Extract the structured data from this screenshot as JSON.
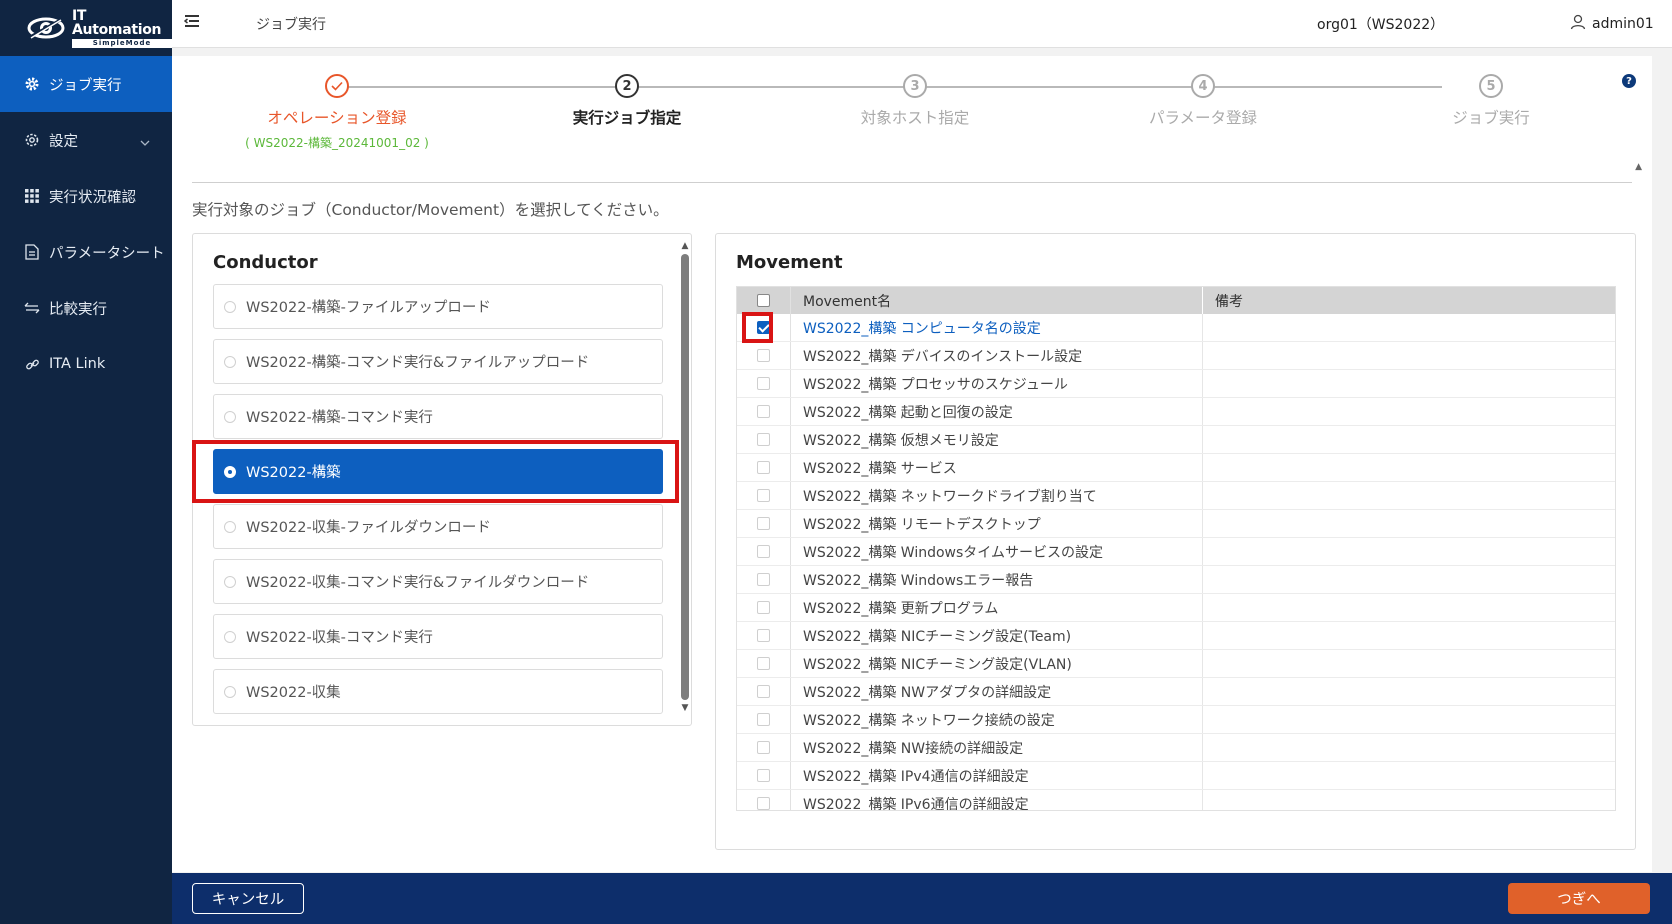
{
  "app": {
    "logo_title": "IT Automation",
    "logo_subtitle": "SimpleMode"
  },
  "sidebar": {
    "items": [
      {
        "label": "ジョブ実行",
        "icon": "gear-icon",
        "active": true
      },
      {
        "label": "設定",
        "icon": "gear-outline-icon",
        "has_chevron": true
      },
      {
        "label": "実行状況確認",
        "icon": "grid-icon"
      },
      {
        "label": "パラメータシート",
        "icon": "document-icon"
      },
      {
        "label": "比較実行",
        "icon": "compare-arrows-icon"
      },
      {
        "label": "ITA Link",
        "icon": "link-icon"
      }
    ]
  },
  "header": {
    "title": "ジョブ実行",
    "org": "org01（WS2022）",
    "user": "admin01"
  },
  "stepper": {
    "steps": [
      {
        "num": "✓",
        "label": "オペレーション登録",
        "sub": "( WS2022-構築_20241001_02 )",
        "state": "done"
      },
      {
        "num": "2",
        "label": "実行ジョブ指定",
        "state": "active"
      },
      {
        "num": "3",
        "label": "対象ホスト指定",
        "state": "pending"
      },
      {
        "num": "4",
        "label": "パラメータ登録",
        "state": "pending"
      },
      {
        "num": "5",
        "label": "ジョブ実行",
        "state": "pending"
      }
    ]
  },
  "instruction": "実行対象のジョブ（Conductor/Movement）を選択してください。",
  "conductor": {
    "title": "Conductor",
    "items": [
      {
        "label": "WS2022-構築-ファイルアップロード",
        "selected": false
      },
      {
        "label": "WS2022-構築-コマンド実行&ファイルアップロード",
        "selected": false
      },
      {
        "label": "WS2022-構築-コマンド実行",
        "selected": false
      },
      {
        "label": "WS2022-構築",
        "selected": true
      },
      {
        "label": "WS2022-収集-ファイルダウンロード",
        "selected": false
      },
      {
        "label": "WS2022-収集-コマンド実行&ファイルダウンロード",
        "selected": false
      },
      {
        "label": "WS2022-収集-コマンド実行",
        "selected": false
      },
      {
        "label": "WS2022-収集",
        "selected": false
      }
    ]
  },
  "movement": {
    "title": "Movement",
    "columns": {
      "name": "Movement名",
      "note": "備考"
    },
    "rows": [
      {
        "name": "WS2022_構築 コンピュータ名の設定",
        "checked": true
      },
      {
        "name": "WS2022_構築 デバイスのインストール設定",
        "checked": false
      },
      {
        "name": "WS2022_構築 プロセッサのスケジュール",
        "checked": false
      },
      {
        "name": "WS2022_構築 起動と回復の設定",
        "checked": false
      },
      {
        "name": "WS2022_構築 仮想メモリ設定",
        "checked": false
      },
      {
        "name": "WS2022_構築 サービス",
        "checked": false
      },
      {
        "name": "WS2022_構築 ネットワークドライブ割り当て",
        "checked": false
      },
      {
        "name": "WS2022_構築 リモートデスクトップ",
        "checked": false
      },
      {
        "name": "WS2022_構築 Windowsタイムサービスの設定",
        "checked": false
      },
      {
        "name": "WS2022_構築 Windowsエラー報告",
        "checked": false
      },
      {
        "name": "WS2022_構築 更新プログラム",
        "checked": false
      },
      {
        "name": "WS2022_構築 NICチーミング設定(Team)",
        "checked": false
      },
      {
        "name": "WS2022_構築 NICチーミング設定(VLAN)",
        "checked": false
      },
      {
        "name": "WS2022_構築 NWアダプタの詳細設定",
        "checked": false
      },
      {
        "name": "WS2022_構築 ネットワーク接続の設定",
        "checked": false
      },
      {
        "name": "WS2022_構築 NW接続の詳細設定",
        "checked": false
      },
      {
        "name": "WS2022_構築 IPv4通信の詳細設定",
        "checked": false
      },
      {
        "name": "WS2022_構築 IPv6通信の詳細設定",
        "checked": false
      }
    ]
  },
  "footer": {
    "cancel_label": "キャンセル",
    "next_label": "つぎへ"
  },
  "colors": {
    "sidebar_bg": "#102542",
    "accent": "#0d5fbf",
    "done_step": "#e8562a",
    "next_button": "#e0612a",
    "highlight": "#d91414"
  }
}
